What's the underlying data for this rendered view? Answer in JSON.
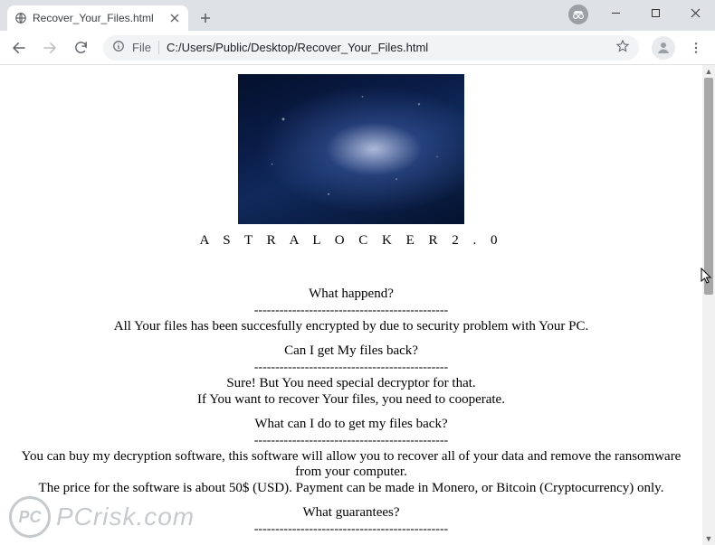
{
  "window": {
    "tab_title": "Recover_Your_Files.html"
  },
  "toolbar": {
    "file_chip": "File",
    "url": "C:/Users/Public/Desktop/Recover_Your_Files.html"
  },
  "note": {
    "brand": "A S T R A L O C K E R 2 . 0",
    "dashes": "----------------------------------------------",
    "sections": {
      "s1_head": "What happend?",
      "s1_body": "All Your files has been succesfully encrypted by  due to security problem with Your PC.",
      "s2_head": "Can I get My files back?",
      "s2_body_a": "Sure! But You need special decryptor for that.",
      "s2_body_b": "If You want to recover Your files, you need to cooperate.",
      "s3_head": "What can I do to get my files back?",
      "s3_body_a": "You can buy my decryption software, this software will allow you to recover all of your data and remove the ransomware from your computer.",
      "s3_body_b": "The price for the software is about 50$ (USD). Payment can be made in Monero, or Bitcoin (Cryptocurrency) only.",
      "s4_head": "What guarantees?"
    }
  },
  "watermark": {
    "badge": "PC",
    "text": "PCrisk.com"
  }
}
